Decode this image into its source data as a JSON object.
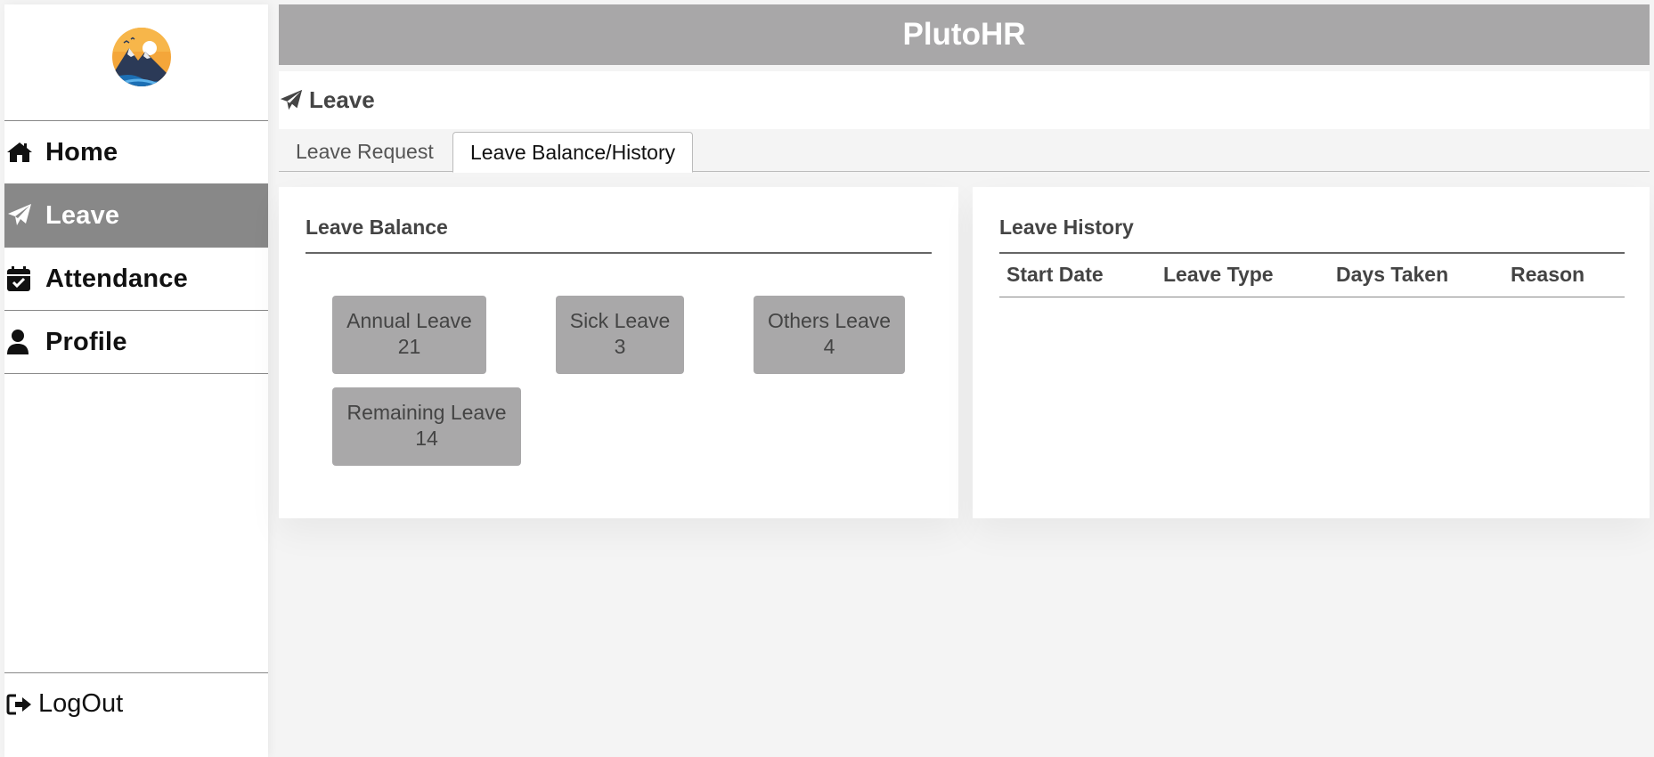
{
  "app": {
    "title": "PlutoHR"
  },
  "sidebar": {
    "logo_icon": "mountain-sun-logo",
    "items": [
      {
        "label": "Home",
        "icon": "home-icon"
      },
      {
        "label": "Leave",
        "icon": "paper-plane-icon",
        "active": true
      },
      {
        "label": "Attendance",
        "icon": "calendar-check-icon"
      },
      {
        "label": "Profile",
        "icon": "user-icon"
      }
    ],
    "logout": {
      "label": "LogOut",
      "icon": "sign-out-icon"
    }
  },
  "page": {
    "title": "Leave",
    "icon": "paper-plane-icon"
  },
  "tabs": [
    {
      "label": "Leave Request",
      "active": false
    },
    {
      "label": "Leave Balance/History",
      "active": true
    }
  ],
  "leave_balance": {
    "title": "Leave Balance",
    "cards": [
      {
        "label": "Annual Leave",
        "value": "21"
      },
      {
        "label": "Sick Leave",
        "value": "3"
      },
      {
        "label": "Others Leave",
        "value": "4"
      },
      {
        "label": "Remaining Leave",
        "value": "14"
      }
    ]
  },
  "leave_history": {
    "title": "Leave History",
    "columns": [
      "Start Date",
      "Leave Type",
      "Days Taken",
      "Reason"
    ],
    "rows": []
  },
  "colors": {
    "header_bg": "#a8a7a8",
    "active_nav_bg": "#888888",
    "card_bg": "#a9a8a9",
    "page_bg": "#f4f4f4"
  }
}
